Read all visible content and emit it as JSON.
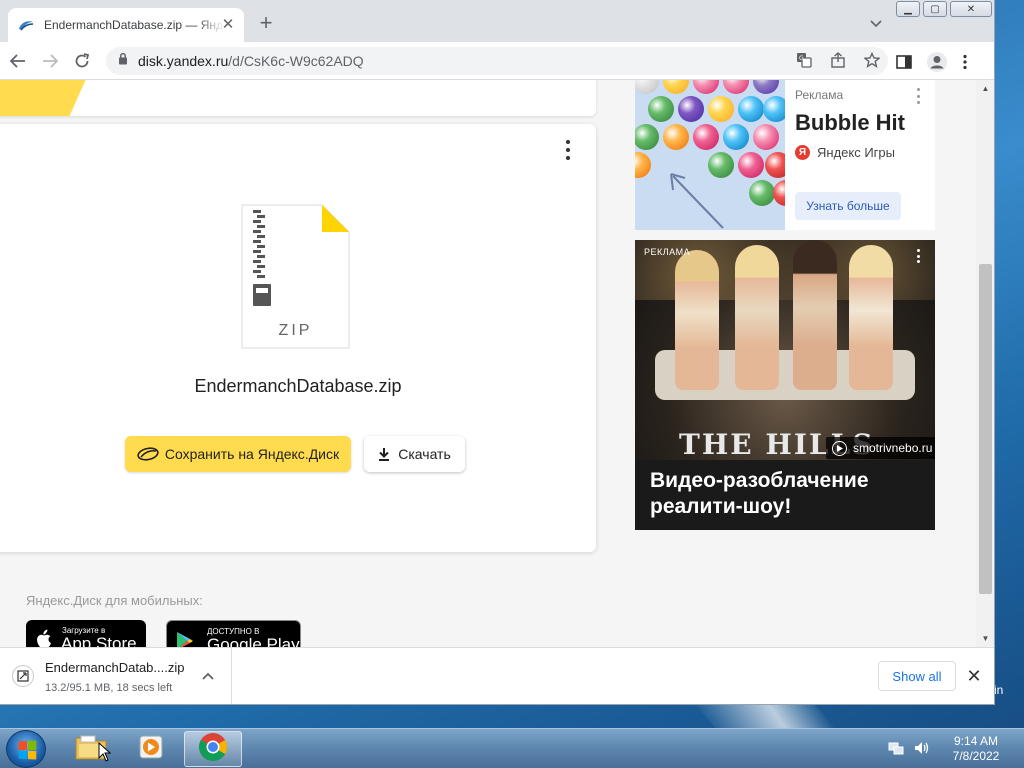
{
  "browser": {
    "tab_title": "EndermanchDatabase.zip — Яндекс.Диск",
    "new_tab_label": "+",
    "url_host": "disk.yandex.ru",
    "url_path": "/d/CsK6c-W9c62ADQ"
  },
  "file": {
    "name": "EndermanchDatabase.zip",
    "type_label": "ZIP",
    "save_button": "Сохранить на Яндекс.Диск",
    "download_button": "Скачать"
  },
  "mobile": {
    "label": "Яндекс.Диск для мобильных:",
    "appstore_small": "Загрузите в",
    "appstore_big": "App Store",
    "gplay_small": "ДОСТУПНО В",
    "gplay_big": "Google Play"
  },
  "ad1": {
    "label": "Реклама",
    "title": "Bubble Hit",
    "brand": "Яндекс Игры",
    "brand_letter": "Я",
    "button": "Узнать больше"
  },
  "ad2": {
    "label": "РЕКЛАМА",
    "show_title": "THE HILLS",
    "source": "smotrivnebo.ru",
    "headline": "Видео-разоблачение реалити-шоу!"
  },
  "download_bar": {
    "file_name": "EndermanchDatab....zip",
    "status": "13.2/95.1 MB, 18 secs left",
    "show_all": "Show all"
  },
  "desktop": {
    "edge_text": "in"
  },
  "taskbar": {
    "time": "9:14 AM",
    "date": "7/8/2022"
  },
  "colors": {
    "yandex_yellow": "#ffdb4d",
    "link_blue": "#1a73e8",
    "ad_button_text": "#2c5bb6"
  }
}
